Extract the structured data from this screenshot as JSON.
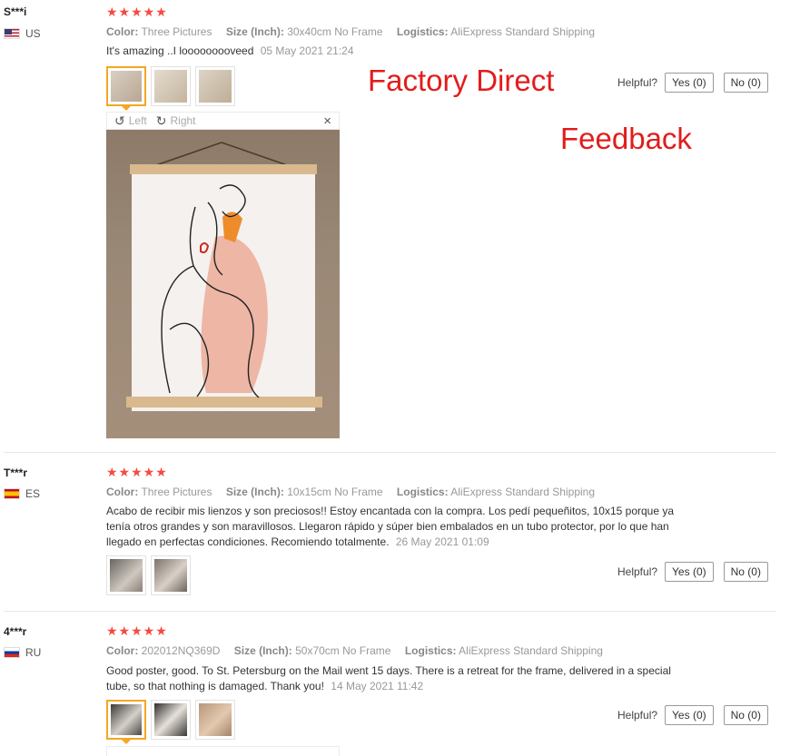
{
  "overlay": {
    "line1": "Factory Direct",
    "line2": "Feedback"
  },
  "labels": {
    "color": "Color:",
    "size": "Size (Inch):",
    "logistics": "Logistics:",
    "helpful": "Helpful?",
    "yes": "Yes (0)",
    "no": "No (0)"
  },
  "viewer": {
    "left": "Left",
    "right": "Right",
    "close": "×"
  },
  "reviews": [
    {
      "user": "S***i",
      "country": "US",
      "rating": 5,
      "stars": "★★★★★",
      "color": "Three Pictures",
      "size": "30x40cm No Frame",
      "logistics": "AliExpress Standard Shipping",
      "text": "It's amazing ..I looooooooveed",
      "date": "05 May 2021 21:24"
    },
    {
      "user": "T***r",
      "country": "ES",
      "rating": 5,
      "stars": "★★★★★",
      "color": "Three Pictures",
      "size": "10x15cm No Frame",
      "logistics": "AliExpress Standard Shipping",
      "text": "Acabo de recibir mis lienzos y son preciosos!! Estoy encantada con la compra. Los pedí pequeñitos, 10x15 porque ya tenía otros grandes y son maravillosos. Llegaron rápido y súper bien embalados en un tubo protector, por lo que han llegado en perfectas condiciones. Recomiendo totalmente.",
      "date": "26 May 2021 01:09"
    },
    {
      "user": "4***r",
      "country": "RU",
      "rating": 5,
      "stars": "★★★★★",
      "color": "202012NQ369D",
      "size": "50x70cm No Frame",
      "logistics": "AliExpress Standard Shipping",
      "text": "Good poster, good. To St. Petersburg on the Mail went 15 days. There is a retreat for the frame, delivered in a special tube, so that nothing is damaged. Thank you!",
      "date": "14 May 2021 11:42"
    }
  ],
  "colors": {
    "accent_red": "#e31c1c",
    "star": "#f44a43",
    "selected_thumb": "#f5a623"
  }
}
